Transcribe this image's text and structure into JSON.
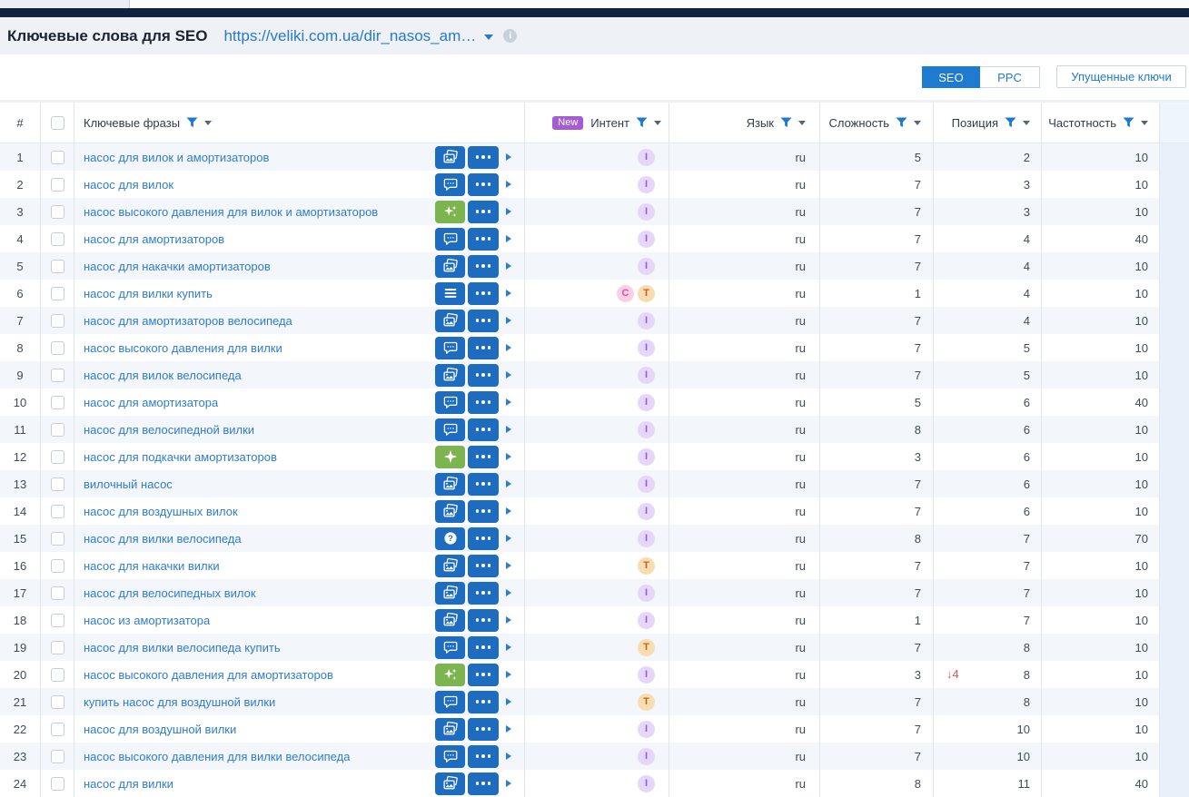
{
  "header": {
    "title": "Ключевые слова для SEO",
    "url": "https://veliki.com.ua/dir_nasos_am…",
    "info_icon": "i"
  },
  "toolbar": {
    "seo_label": "SEO",
    "ppc_label": "PPC",
    "missed_keys_label": "Упущенные ключи"
  },
  "table": {
    "header": {
      "num": "#",
      "phrase": "Ключевые фразы",
      "new_badge": "New",
      "intent": "Интент",
      "lang": "Язык",
      "difficulty": "Сложность",
      "position": "Позиция",
      "frequency": "Частотность"
    },
    "rows": [
      {
        "n": 1,
        "phrase": "насос для вилок и амортизаторов",
        "icon": "photos",
        "intents": [
          "I"
        ],
        "lang": "ru",
        "difficulty": 5,
        "position": 2,
        "frequency": 10
      },
      {
        "n": 2,
        "phrase": "насос для вилок",
        "icon": "chat",
        "intents": [
          "I"
        ],
        "lang": "ru",
        "difficulty": 7,
        "position": 3,
        "frequency": 10
      },
      {
        "n": 3,
        "phrase": "насос высокого давления для вилок и амортизаторов",
        "icon": "sparkles",
        "intents": [
          "I"
        ],
        "lang": "ru",
        "difficulty": 7,
        "position": 3,
        "frequency": 10
      },
      {
        "n": 4,
        "phrase": "насос для амортизаторов",
        "icon": "chat",
        "intents": [
          "I"
        ],
        "lang": "ru",
        "difficulty": 7,
        "position": 4,
        "frequency": 40
      },
      {
        "n": 5,
        "phrase": "насос для накачки амортизаторов",
        "icon": "photos",
        "intents": [
          "I"
        ],
        "lang": "ru",
        "difficulty": 7,
        "position": 4,
        "frequency": 10
      },
      {
        "n": 6,
        "phrase": "насос для вилки купить",
        "icon": "menu",
        "intents": [
          "C",
          "T"
        ],
        "lang": "ru",
        "difficulty": 1,
        "position": 4,
        "frequency": 10
      },
      {
        "n": 7,
        "phrase": "насос для амортизаторов велосипеда",
        "icon": "photos",
        "intents": [
          "I"
        ],
        "lang": "ru",
        "difficulty": 7,
        "position": 4,
        "frequency": 10
      },
      {
        "n": 8,
        "phrase": "насос высокого давления для вилки",
        "icon": "chat",
        "intents": [
          "I"
        ],
        "lang": "ru",
        "difficulty": 7,
        "position": 5,
        "frequency": 10
      },
      {
        "n": 9,
        "phrase": "насос для вилок велосипеда",
        "icon": "photos",
        "intents": [
          "I"
        ],
        "lang": "ru",
        "difficulty": 7,
        "position": 5,
        "frequency": 10
      },
      {
        "n": 10,
        "phrase": "насос для амортизатора",
        "icon": "chat",
        "intents": [
          "I"
        ],
        "lang": "ru",
        "difficulty": 5,
        "position": 6,
        "frequency": 40
      },
      {
        "n": 11,
        "phrase": "насос для велосипедной вилки",
        "icon": "chat",
        "intents": [
          "I"
        ],
        "lang": "ru",
        "difficulty": 8,
        "position": 6,
        "frequency": 10
      },
      {
        "n": 12,
        "phrase": "насос для подкачки амортизаторов",
        "icon": "sparkle",
        "intents": [
          "I"
        ],
        "lang": "ru",
        "difficulty": 3,
        "position": 6,
        "frequency": 10
      },
      {
        "n": 13,
        "phrase": "вилочный насос",
        "icon": "photos",
        "intents": [
          "I"
        ],
        "lang": "ru",
        "difficulty": 7,
        "position": 6,
        "frequency": 10
      },
      {
        "n": 14,
        "phrase": "насос для воздушных вилок",
        "icon": "photos",
        "intents": [
          "I"
        ],
        "lang": "ru",
        "difficulty": 7,
        "position": 6,
        "frequency": 10
      },
      {
        "n": 15,
        "phrase": "насос для вилки велосипеда",
        "icon": "question",
        "intents": [
          "I"
        ],
        "lang": "ru",
        "difficulty": 8,
        "position": 7,
        "frequency": 70
      },
      {
        "n": 16,
        "phrase": "насос для накачки вилки",
        "icon": "photos",
        "intents": [
          "T"
        ],
        "lang": "ru",
        "difficulty": 7,
        "position": 7,
        "frequency": 10
      },
      {
        "n": 17,
        "phrase": "насос для велосипедных вилок",
        "icon": "photos",
        "intents": [
          "I"
        ],
        "lang": "ru",
        "difficulty": 7,
        "position": 7,
        "frequency": 10
      },
      {
        "n": 18,
        "phrase": "насос из амортизатора",
        "icon": "photos",
        "intents": [
          "I"
        ],
        "lang": "ru",
        "difficulty": 1,
        "position": 7,
        "frequency": 10
      },
      {
        "n": 19,
        "phrase": "насос для вилки велосипеда купить",
        "icon": "chat",
        "intents": [
          "T"
        ],
        "lang": "ru",
        "difficulty": 7,
        "position": 8,
        "frequency": 10
      },
      {
        "n": 20,
        "phrase": "насос высокого давления для амортизаторов",
        "icon": "sparkles",
        "intents": [
          "I"
        ],
        "lang": "ru",
        "difficulty": 3,
        "position": 8,
        "frequency": 10,
        "pos_change": "↓4"
      },
      {
        "n": 21,
        "phrase": "купить насос для воздушной вилки",
        "icon": "chat",
        "intents": [
          "T"
        ],
        "lang": "ru",
        "difficulty": 7,
        "position": 8,
        "frequency": 10
      },
      {
        "n": 22,
        "phrase": "насос для воздушной вилки",
        "icon": "photos",
        "intents": [
          "I"
        ],
        "lang": "ru",
        "difficulty": 7,
        "position": 10,
        "frequency": 10
      },
      {
        "n": 23,
        "phrase": "насос высокого давления для вилки велосипеда",
        "icon": "chat",
        "intents": [
          "I"
        ],
        "lang": "ru",
        "difficulty": 7,
        "position": 10,
        "frequency": 10
      },
      {
        "n": 24,
        "phrase": "насос для вилки",
        "icon": "photos",
        "intents": [
          "I"
        ],
        "lang": "ru",
        "difficulty": 8,
        "position": 11,
        "frequency": 40
      }
    ]
  },
  "colors": {
    "accent_blue": "#1f7ad1",
    "icon_blue": "#1e6cc0",
    "icon_green": "#7cb450",
    "navy_bar": "#0d2340",
    "link_blue": "#2e7cd0",
    "zebra_row": "#f3f6fa",
    "new_badge": "#a55cd3",
    "intent_i_bg": "#e6d7f8",
    "intent_c_bg": "#f8cfe7",
    "intent_t_bg": "#f8dcb2",
    "position_drop_red": "#e15555"
  }
}
